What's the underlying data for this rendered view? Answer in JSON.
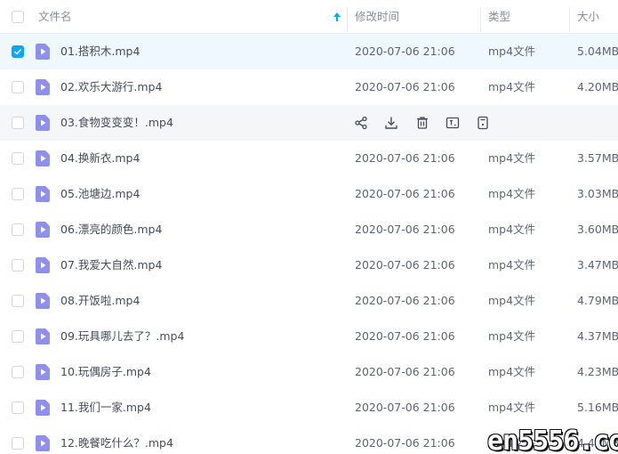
{
  "header": {
    "name_label": "文件名",
    "modified_label": "修改时间",
    "type_label": "类型",
    "size_label": "大小"
  },
  "colors": {
    "accent": "#06a7ff",
    "file_icon": "#8e8ff2",
    "selected_row": "#eef8fe",
    "hover_row": "#f5f6f8"
  },
  "hover_actions": [
    "share-icon",
    "download-icon",
    "delete-icon",
    "rename-icon",
    "more-icon"
  ],
  "files": [
    {
      "name": "01.搭积木.mp4",
      "modified": "2020-07-06 21:06",
      "type": "mp4文件",
      "size": "5.04MB",
      "selected": true
    },
    {
      "name": "02.欢乐大游行.mp4",
      "modified": "2020-07-06 21:06",
      "type": "mp4文件",
      "size": "4.20MB"
    },
    {
      "name": "03.食物变变变！.mp4",
      "modified": "",
      "type": "",
      "size": "",
      "hovered": true
    },
    {
      "name": "04.换新衣.mp4",
      "modified": "2020-07-06 21:06",
      "type": "mp4文件",
      "size": "3.57MB"
    },
    {
      "name": "05.池塘边.mp4",
      "modified": "2020-07-06 21:06",
      "type": "mp4文件",
      "size": "3.03MB"
    },
    {
      "name": "06.漂亮的颜色.mp4",
      "modified": "2020-07-06 21:06",
      "type": "mp4文件",
      "size": "3.60MB"
    },
    {
      "name": "07.我爱大自然.mp4",
      "modified": "2020-07-06 21:06",
      "type": "mp4文件",
      "size": "3.47MB"
    },
    {
      "name": "08.开饭啦.mp4",
      "modified": "2020-07-06 21:06",
      "type": "mp4文件",
      "size": "4.79MB"
    },
    {
      "name": "09.玩具哪儿去了？.mp4",
      "modified": "2020-07-06 21:06",
      "type": "mp4文件",
      "size": "4.37MB"
    },
    {
      "name": "10.玩偶房子.mp4",
      "modified": "2020-07-06 21:06",
      "type": "mp4文件",
      "size": "4.23MB"
    },
    {
      "name": "11.我们一家.mp4",
      "modified": "2020-07-06 21:06",
      "type": "mp4文件",
      "size": "5.16MB"
    },
    {
      "name": "12.晚餐吃什么？.mp4",
      "modified": "2020-07-06 21:06",
      "type": "mp4文件",
      "size": "4.41MB"
    }
  ],
  "watermark": "en5556.com"
}
